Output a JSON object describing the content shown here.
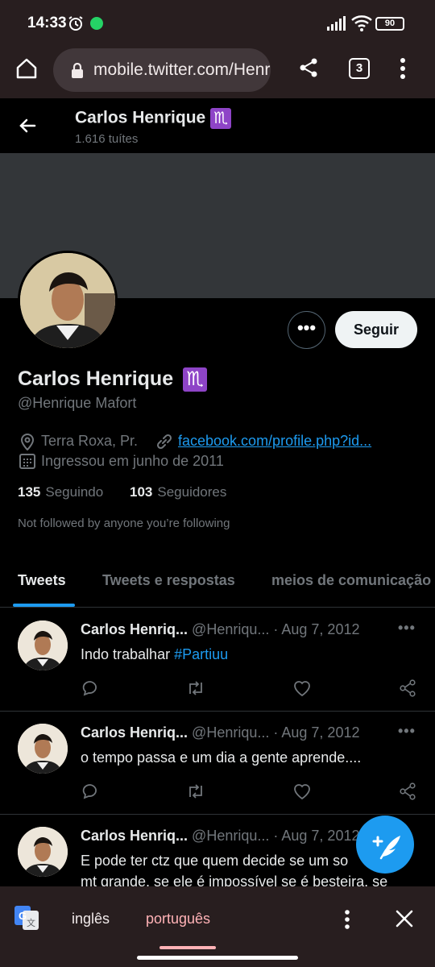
{
  "status_bar": {
    "time": "14:33",
    "battery": "90"
  },
  "browser": {
    "url": "mobile.twitter.com/Henrique",
    "tab_count": "3"
  },
  "header": {
    "name": "Carlos Henrique",
    "zodiac": "♏",
    "tweet_count": "1.616 tuítes"
  },
  "profile": {
    "name": "Carlos Henrique",
    "zodiac": "♏",
    "handle": "@Henrique Mafort",
    "location": "Terra Roxa, Pr.",
    "link": "facebook.com/profile.php?id...",
    "joined": "Ingressou em junho de 2011",
    "following_count": "135",
    "following_label": "Seguindo",
    "followers_count": "103",
    "followers_label": "Seguidores",
    "not_followed": "Not followed by anyone you’re following",
    "more_label": "•••",
    "follow_label": "Seguir"
  },
  "tabs": [
    {
      "label": "Tweets",
      "active": true
    },
    {
      "label": "Tweets e respostas",
      "active": false
    },
    {
      "label": "meios de comunicação",
      "active": false
    }
  ],
  "tweets": [
    {
      "name": "Carlos Henriq...",
      "handle": "@Henriqu...",
      "sep": "·",
      "date": "Aug 7, 2012",
      "text": "Indo trabalhar ",
      "hashtag": "#Partiuu"
    },
    {
      "name": "Carlos Henriq...",
      "handle": "@Henriqu...",
      "sep": "·",
      "date": "Aug 7, 2012",
      "text": "o tempo passa e um dia a gente aprende....",
      "hashtag": ""
    },
    {
      "name": "Carlos Henriq...",
      "handle": "@Henriqu...",
      "sep": "·",
      "date": "Aug 7, 2012",
      "text": "E pode ter ctz que quem decide se um so",
      "text2": "mt grande, se ele é impossível se é besteira, se",
      "hashtag": ""
    }
  ],
  "translate": {
    "source_lang": "inglês",
    "target_lang": "português"
  },
  "icons": {
    "back": "arrow-left-icon",
    "home": "home-icon",
    "lock": "lock-icon",
    "share": "share-icon",
    "menu": "vertical-dots-icon",
    "location": "location-pin-icon",
    "link": "link-icon",
    "calendar": "calendar-icon",
    "reply": "reply-icon",
    "retweet": "retweet-icon",
    "like": "heart-icon",
    "compose": "compose-tweet-icon",
    "translate": "google-translate-icon",
    "close": "close-icon"
  },
  "colors": {
    "accent": "#1d9bf0",
    "browser_chrome": "#281e1f",
    "zodiac_badge": "#8e44c7",
    "active_lang": "#ffb2b6"
  }
}
